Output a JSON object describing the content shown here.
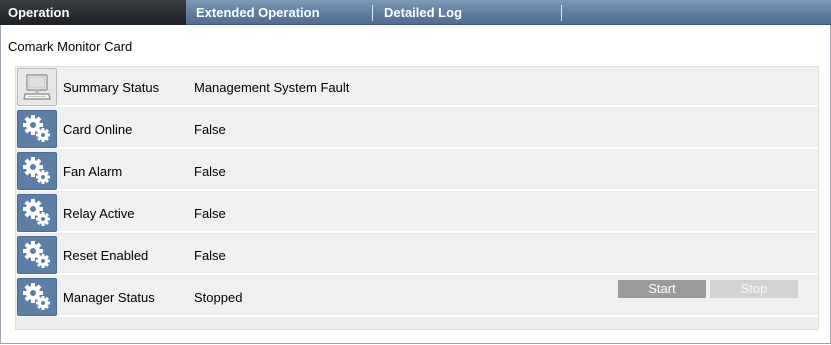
{
  "tabs": [
    {
      "label": "Operation",
      "active": true
    },
    {
      "label": "Extended Operation",
      "active": false
    },
    {
      "label": "Detailed Log",
      "active": false
    }
  ],
  "card": {
    "title": "Comark Monitor Card",
    "rows": [
      {
        "label": "Summary Status",
        "value": "Management System Fault",
        "icon": "computer-icon"
      },
      {
        "label": "Card Online",
        "value": "False",
        "icon": "gears-icon"
      },
      {
        "label": "Fan Alarm",
        "value": "False",
        "icon": "gears-icon"
      },
      {
        "label": "Relay Active",
        "value": "False",
        "icon": "gears-icon"
      },
      {
        "label": "Reset Enabled",
        "value": "False",
        "icon": "gears-icon"
      },
      {
        "label": "Manager Status",
        "value": "Stopped",
        "icon": "gears-icon"
      }
    ]
  },
  "buttons": {
    "start": "Start",
    "stop": "Stop"
  },
  "colors": {
    "tab_bar": "#5f7d9f",
    "active_tab": "#1d2024",
    "gear_tile": "#5e7fa5",
    "start_button": "#9a9a9a",
    "stop_button": "#d2d2d2"
  }
}
